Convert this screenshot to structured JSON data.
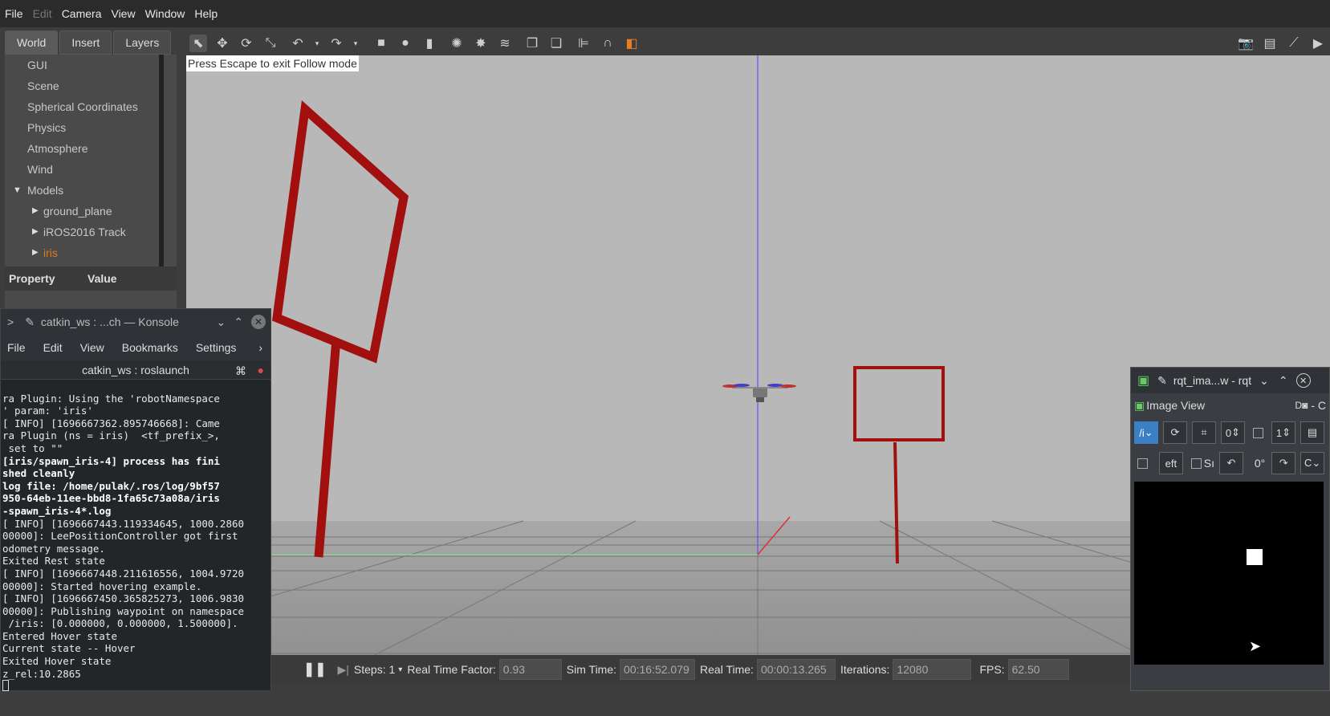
{
  "menubar": {
    "file": "File",
    "edit": "Edit",
    "camera": "Camera",
    "view": "View",
    "window": "Window",
    "help": "Help"
  },
  "tabs": {
    "world": "World",
    "insert": "Insert",
    "layers": "Layers"
  },
  "tree": [
    {
      "label": "GUI",
      "depth": 1
    },
    {
      "label": "Scene",
      "depth": 1
    },
    {
      "label": "Spherical Coordinates",
      "depth": 1
    },
    {
      "label": "Physics",
      "depth": 1
    },
    {
      "label": "Atmosphere",
      "depth": 1
    },
    {
      "label": "Wind",
      "depth": 1
    },
    {
      "label": "Models",
      "depth": 1
    },
    {
      "label": "ground_plane",
      "depth": 2
    },
    {
      "label": "iROS2016 Track",
      "depth": 2
    },
    {
      "label": "iris",
      "depth": 2
    }
  ],
  "properties": {
    "property": "Property",
    "value": "Value"
  },
  "viewport": {
    "hint": "Press Escape to exit Follow mode"
  },
  "bottombar": {
    "steps_label": "Steps: 1",
    "rtf_label": "Real Time Factor:",
    "rtf": "0.93",
    "simtime_label": "Sim Time:",
    "simtime": "00:16:52.079",
    "realtime_label": "Real Time:",
    "realtime": "00:00:13.265",
    "iter_label": "Iterations:",
    "iter": "12080",
    "fps_label": "FPS:",
    "fps": "62.50"
  },
  "konsole": {
    "title": "catkin_ws : ...ch — Konsole",
    "menu": {
      "file": "File",
      "edit": "Edit",
      "view": "View",
      "bookmarks": "Bookmarks",
      "settings": "Settings"
    },
    "tab": "catkin_ws : roslaunch",
    "lines": [
      "ra Plugin: Using the 'robotNamespace",
      "' param: 'iris'",
      "[ INFO] [1696667362.895746668]: Came",
      "ra Plugin (ns = iris)  <tf_prefix_>,",
      " set to \"\"",
      "[iris/spawn_iris-4] process has fini",
      "shed cleanly",
      "log file: /home/pulak/.ros/log/9bf57",
      "950-64eb-11ee-bbd8-1fa65c73a08a/iris",
      "-spawn_iris-4*.log",
      "[ INFO] [1696667443.119334645, 1000.2860",
      "00000]: LeePositionController got first",
      "odometry message.",
      "Exited Rest state",
      "[ INFO] [1696667448.211616556, 1004.9720",
      "00000]: Started hovering example.",
      "[ INFO] [1696667450.365825273, 1006.9830",
      "00000]: Publishing waypoint on namespace",
      " /iris: [0.000000, 0.000000, 1.500000].",
      "Entered Hover state",
      "Current state -- Hover",
      "Exited Hover state",
      "z_rel:10.2865"
    ]
  },
  "rqt": {
    "title": "rqt_ima...w - rqt",
    "plugin": "Image View",
    "topic": "/i",
    "num1": "0",
    "num2": "1",
    "eft": "eft",
    "sr": "Sı",
    "deg": "0°",
    "cropped_label": "- C"
  }
}
